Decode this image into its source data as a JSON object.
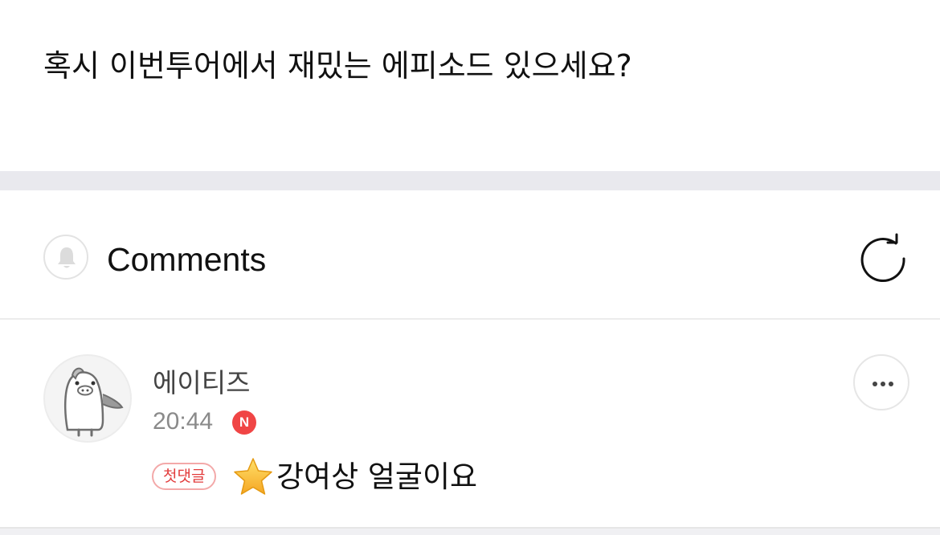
{
  "post": {
    "text": "혹시 이번투어에서 재밌는 에피소드 있으세요?"
  },
  "comments_header": {
    "title": "Comments",
    "notify_icon": "bell-icon",
    "refresh_icon": "refresh-icon"
  },
  "comment": {
    "author": "에이티즈",
    "time": "20:44",
    "new_badge": "N",
    "first_comment_label": "첫댓글",
    "emoji_icon": "star-emoji",
    "text": "강여상 얼굴이요",
    "more_icon": "more-horizontal-icon"
  },
  "colors": {
    "new_badge": "#f04545",
    "first_comment_border": "#f3a9a9",
    "first_comment_text": "#e23c3c",
    "section_gap": "#e9e9ee",
    "star": "#ffc83d"
  }
}
